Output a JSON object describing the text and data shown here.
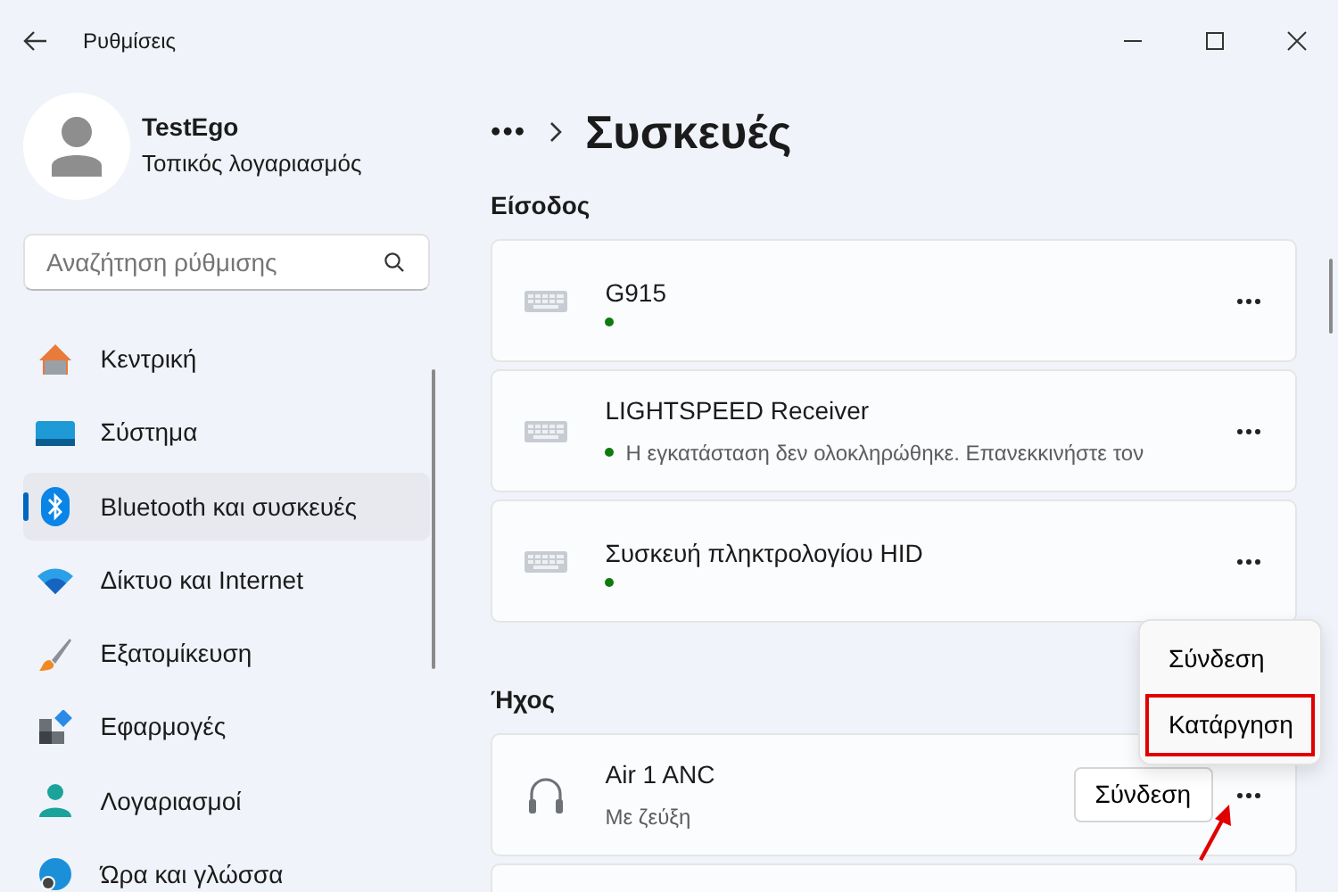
{
  "window": {
    "title": "Ρυθμίσεις"
  },
  "profile": {
    "name": "TestEgo",
    "account_type": "Τοπικός λογαριασμός"
  },
  "search": {
    "placeholder": "Αναζήτηση ρύθμισης"
  },
  "sidebar": {
    "items": [
      {
        "label": "Κεντρική",
        "kind": "home",
        "selected": false
      },
      {
        "label": "Σύστημα",
        "kind": "system",
        "selected": false
      },
      {
        "label": "Bluetooth και συσκευές",
        "kind": "bluetooth",
        "selected": true
      },
      {
        "label": "Δίκτυο και Internet",
        "kind": "wifi",
        "selected": false
      },
      {
        "label": "Εξατομίκευση",
        "kind": "brush",
        "selected": false
      },
      {
        "label": "Εφαρμογές",
        "kind": "apps",
        "selected": false
      },
      {
        "label": "Λογαριασμοί",
        "kind": "account",
        "selected": false
      },
      {
        "label": "Ώρα και γλώσσα",
        "kind": "globe",
        "selected": false
      }
    ]
  },
  "breadcrumb": {
    "overflow": "•••",
    "title": "Συσκευές"
  },
  "sections": [
    {
      "heading": "Είσοδος",
      "devices": [
        {
          "name": "G915",
          "kind": "keyboard",
          "connected": true
        },
        {
          "name": "LIGHTSPEED Receiver",
          "kind": "keyboard",
          "connected": true,
          "status": "Η εγκατάσταση δεν ολοκληρώθηκε. Επανεκκινήστε τον"
        },
        {
          "name": "Συσκευή πληκτρολογίου HID",
          "kind": "keyboard",
          "connected": true
        }
      ]
    },
    {
      "heading": "Ήχος",
      "devices": [
        {
          "name": "Air 1 ANC",
          "kind": "headphones",
          "connected": false,
          "status": "Με ζεύξη",
          "button": "Σύνδεση"
        },
        {
          "kind": "blank"
        }
      ]
    }
  ],
  "context_menu": {
    "items": [
      {
        "label": "Σύνδεση",
        "highlighted": false
      },
      {
        "label": "Κατάργηση",
        "highlighted": true
      }
    ]
  }
}
